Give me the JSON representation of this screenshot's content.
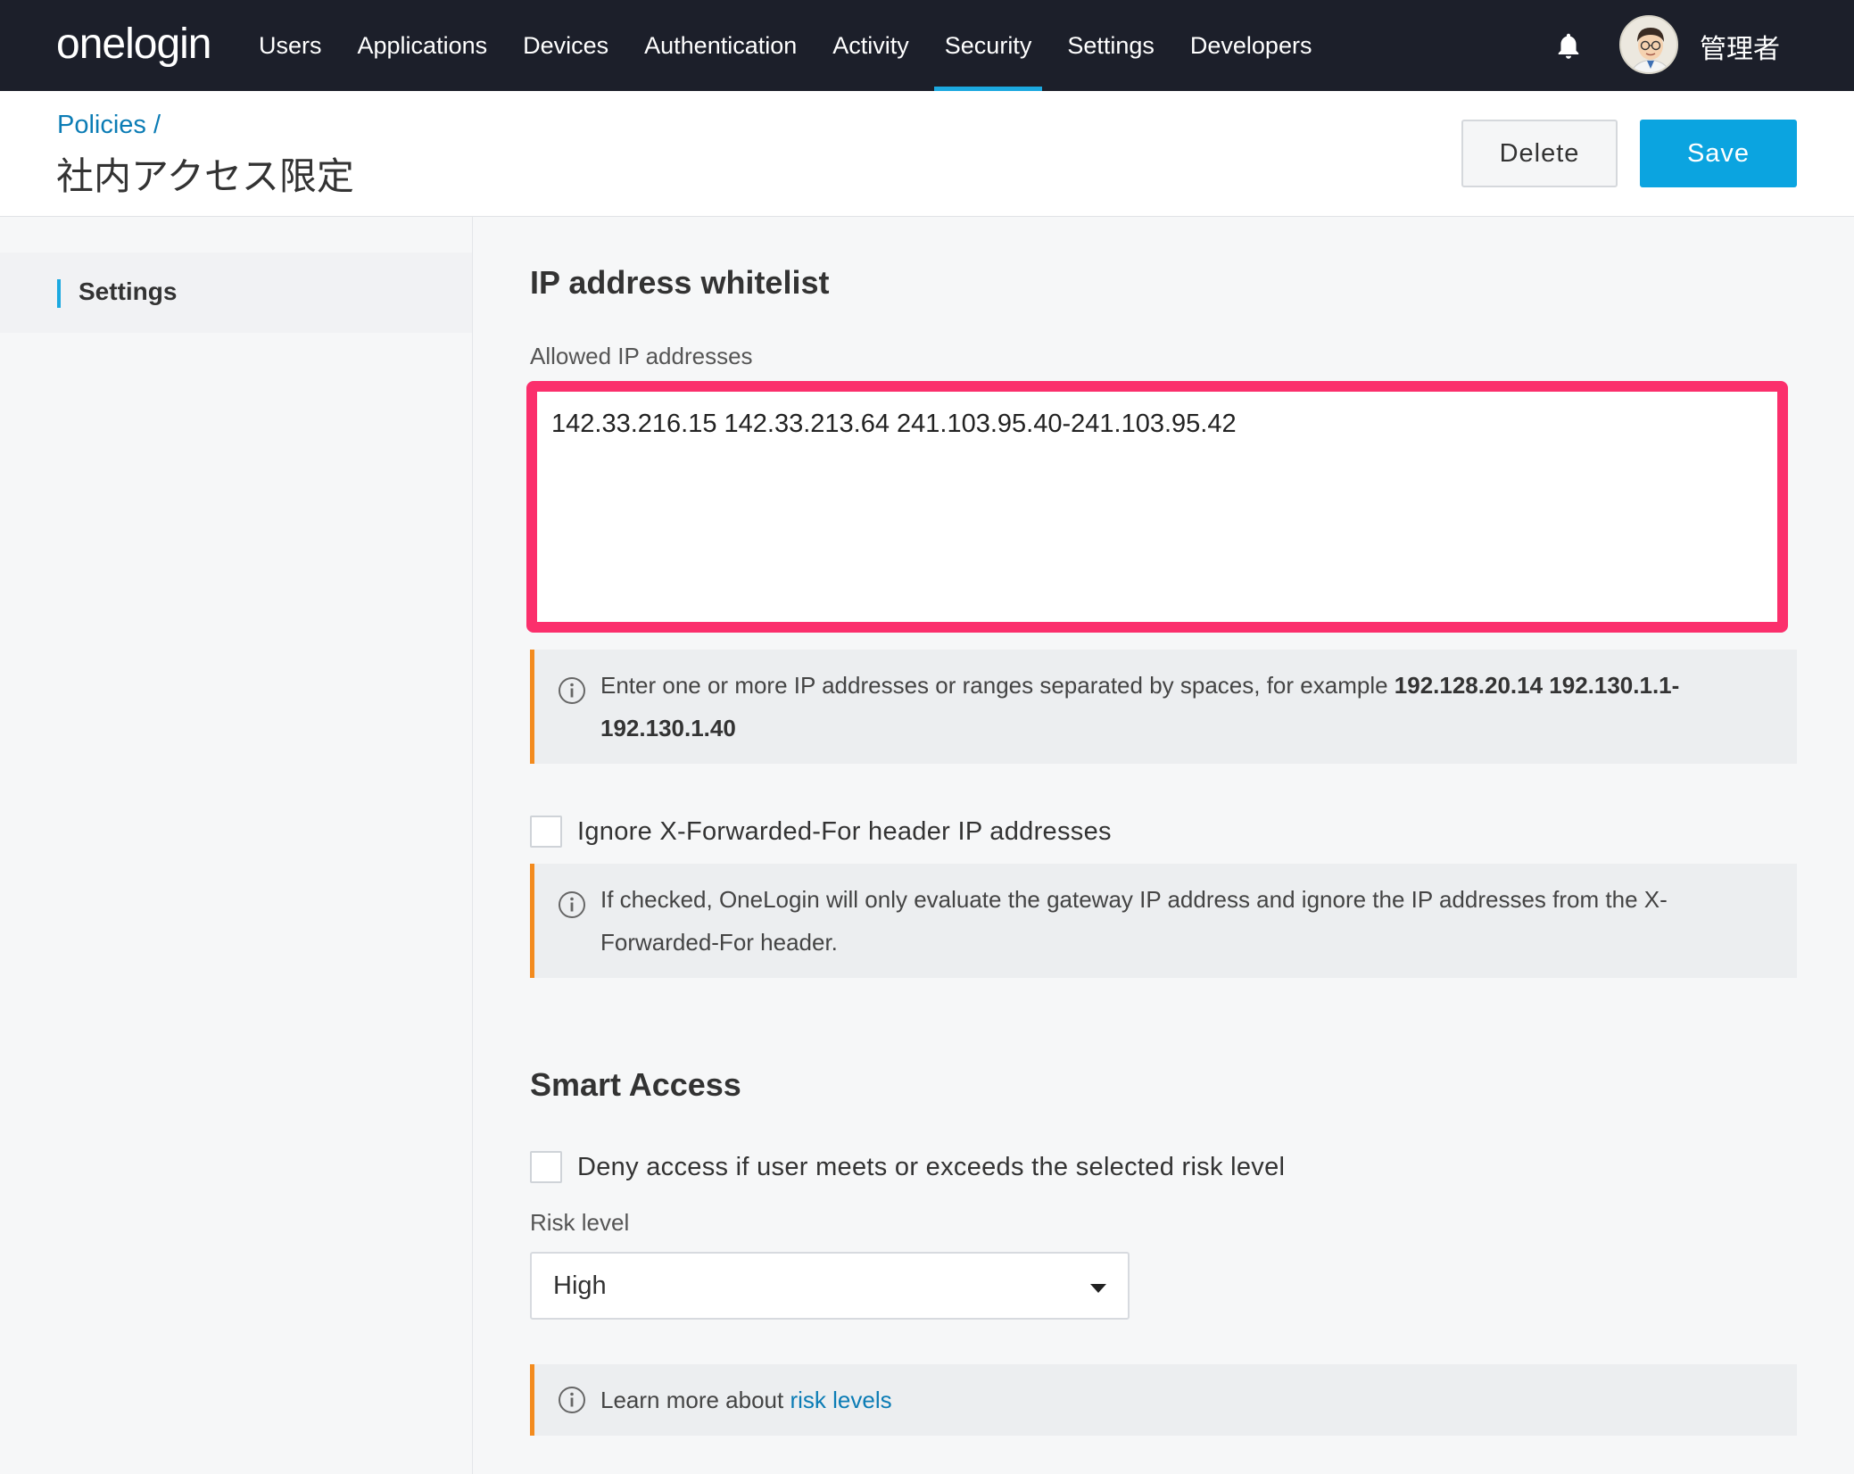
{
  "nav": {
    "logo": "onelogin",
    "items": [
      "Users",
      "Applications",
      "Devices",
      "Authentication",
      "Activity",
      "Security",
      "Settings",
      "Developers"
    ],
    "active": "Security",
    "user_name": "管理者"
  },
  "header": {
    "breadcrumb": "Policies /",
    "title": "社内アクセス限定",
    "delete_label": "Delete",
    "save_label": "Save"
  },
  "sidebar": {
    "items": [
      {
        "label": "Settings"
      }
    ]
  },
  "ip_whitelist": {
    "title": "IP address whitelist",
    "field_label": "Allowed IP addresses",
    "value": "142.33.216.15 142.33.213.64 241.103.95.40-241.103.95.42",
    "hint_text": "Enter one or more IP addresses or ranges separated by spaces, for example ",
    "hint_example": "192.128.20.14 192.130.1.1-192.130.1.40",
    "ignore_xff_label": "Ignore X-Forwarded-For header IP addresses",
    "ignore_xff_checked": false,
    "ignore_xff_hint": "If checked, OneLogin will only evaluate the gateway IP address and ignore the IP addresses from the X-Forwarded-For header."
  },
  "smart_access": {
    "title": "Smart Access",
    "deny_label": "Deny access if user meets or exceeds the selected risk level",
    "deny_checked": false,
    "risk_label": "Risk level",
    "risk_value": "High",
    "learn_text": "Learn more about ",
    "learn_link": "risk levels"
  },
  "colors": {
    "nav_bg": "#1c1f2a",
    "accent": "#1ca9e0",
    "save_button": "#0ba4e0",
    "highlight_border": "#fb2f6c",
    "info_border": "#f38b1e",
    "link": "#0b7cb5"
  }
}
